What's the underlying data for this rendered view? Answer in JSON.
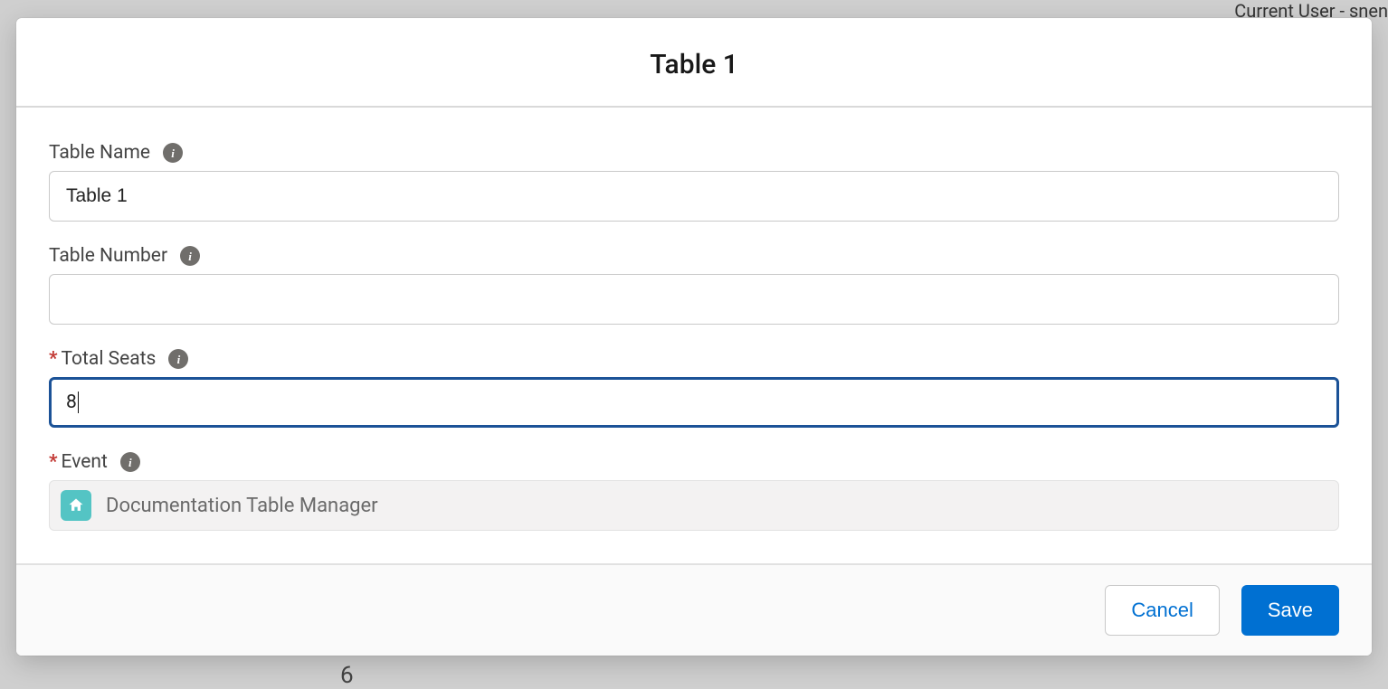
{
  "background": {
    "user_label": "Current User - snen",
    "bottom_value": "6"
  },
  "modal": {
    "title": "Table 1",
    "fields": {
      "table_name": {
        "label": "Table Name",
        "value": "Table 1",
        "required": false
      },
      "table_number": {
        "label": "Table Number",
        "value": "",
        "required": false
      },
      "total_seats": {
        "label": "Total Seats",
        "value": "8",
        "required": true
      },
      "event": {
        "label": "Event",
        "value": "Documentation Table Manager",
        "required": true,
        "icon": "event-home-icon"
      }
    },
    "buttons": {
      "cancel": "Cancel",
      "save": "Save"
    }
  }
}
